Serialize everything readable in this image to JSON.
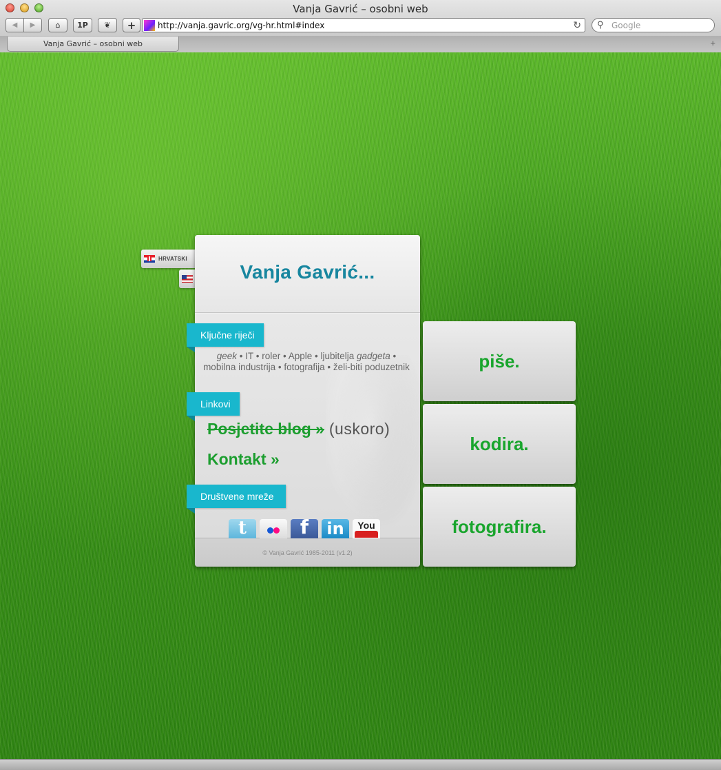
{
  "window": {
    "title": "Vanja Gavrić – osobni web"
  },
  "toolbar": {
    "top_sites_label": "1P",
    "add_label": "+",
    "url": "http://vanja.gavric.org/vg-hr.html#index",
    "search_placeholder": "Google"
  },
  "tabs": [
    {
      "label": "Vanja Gavrić – osobni web"
    }
  ],
  "language": {
    "croatian_label": "HRVATSKI"
  },
  "card": {
    "title": "Vanja Gavrić...",
    "sections": {
      "keywords_label": "Ključne riječi",
      "links_label": "Linkovi",
      "social_label": "Društvene mreže"
    },
    "keywords": {
      "geek": "geek",
      "part1": " • IT • roler • Apple • ljubitelja ",
      "gadgeta": "gadgeta",
      "part2": " • mobilna industrija • fotografija • želi-biti poduzetnik"
    },
    "links": {
      "blog": "Posjetite blog »",
      "soon": " (uskoro)",
      "contact": "Kontakt »"
    },
    "social": {
      "twitter": "t",
      "facebook": "f",
      "linkedin": "in",
      "youtube": "You"
    },
    "footer": "© Vanja Gavrić 1985-2011 (v1.2)"
  },
  "tiles": [
    {
      "label": "piše."
    },
    {
      "label": "kodira."
    },
    {
      "label": "fotografira."
    }
  ]
}
